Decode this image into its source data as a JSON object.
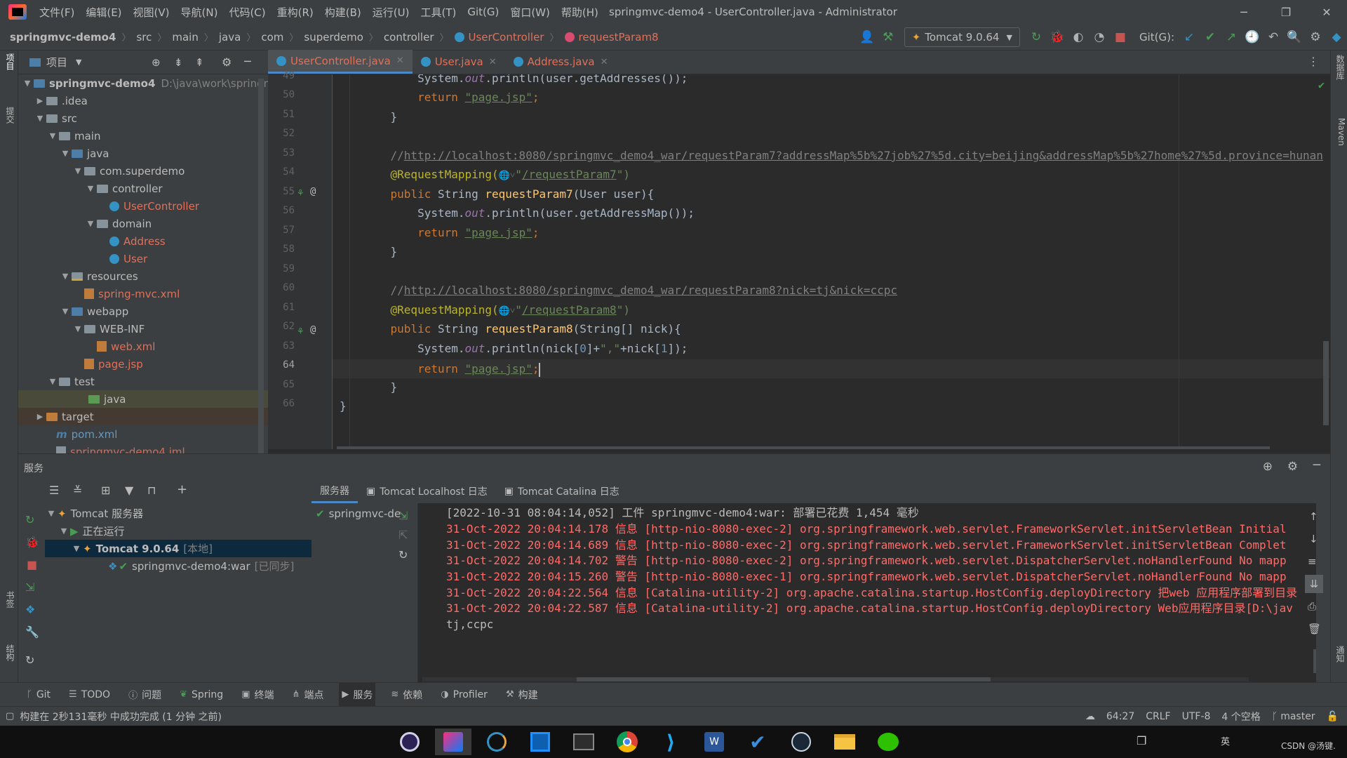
{
  "window": {
    "title": "springmvc-demo4 - UserController.java - Administrator",
    "menu": [
      "文件(F)",
      "编辑(E)",
      "视图(V)",
      "导航(N)",
      "代码(C)",
      "重构(R)",
      "构建(B)",
      "运行(U)",
      "工具(T)",
      "Git(G)",
      "窗口(W)",
      "帮助(H)"
    ],
    "minimize": "─",
    "restore": "❐",
    "close": "✕"
  },
  "navbar": {
    "breadcrumbs": [
      "springmvc-demo4",
      "src",
      "main",
      "java",
      "com",
      "superdemo",
      "controller",
      "UserController",
      "requestParam8"
    ],
    "run_config": "Tomcat 9.0.64",
    "git_label": "Git(G):"
  },
  "left_strip": {
    "project_tab": "项目",
    "commit_tab": "提交",
    "bookmarks_tab": "书签",
    "structure_tab": "结构"
  },
  "right_strip": {
    "database_tab": "数据库",
    "maven_tab": "Maven",
    "notifications_tab": "通知"
  },
  "project": {
    "header": "项目",
    "root_name": "springmvc-demo4",
    "root_path": "D:\\java\\work\\springm",
    "items": [
      ".idea",
      "src",
      "main",
      "java",
      "com.superdemo",
      "controller",
      "UserController",
      "domain",
      "Address",
      "User",
      "resources",
      "spring-mvc.xml",
      "webapp",
      "WEB-INF",
      "web.xml",
      "page.jsp",
      "test",
      "java",
      "target",
      "pom.xml",
      "springmvc-demo4.iml"
    ]
  },
  "editor": {
    "tabs": [
      "UserController.java",
      "User.java",
      "Address.java"
    ],
    "line_numbers": [
      "49",
      "50",
      "51",
      "52",
      "53",
      "54",
      "55",
      "56",
      "57",
      "58",
      "59",
      "60",
      "61",
      "62",
      "63",
      "64",
      "65",
      "66"
    ],
    "current_line": "64",
    "code": {
      "l49a": "        System.",
      "l49b": "out",
      "l49c": ".println(user.getAddresses());",
      "l50kw": "        return ",
      "l50s": "\"page.jsp\"",
      "semi": ";",
      "l51": "    }",
      "l53a": "    //",
      "l53url": "http://localhost:8080/springmvc_demo4_war/requestParam7?addressMap%5b%27job%27%5d.city=beijing&addressMap%5b%27home%27%5d.province=hunan",
      "l54ann": "    @RequestMapping(",
      "l54q": "\"",
      "l54url": "/requestParam7",
      "l54end": "\")",
      "l55kw": "    public ",
      "l55type": "String ",
      "l55fn": "requestParam7",
      "l55rest": "(User user){",
      "l56c": ".println(user.getAddressMap());",
      "l58": "    }",
      "l60url": "http://localhost:8080/springmvc_demo4_war/requestParam8?nick=tj&nick=ccpc",
      "l61url": "/requestParam8",
      "l62fn": "requestParam8",
      "l62rest": "(String[] nick){",
      "l63c": ".println(nick[",
      "l63n0": "0",
      "l63m": "]+",
      "l63s": "\",\"",
      "l63m2": "+nick[",
      "l63n1": "1",
      "l63e": "]);",
      "l65": "    }",
      "l66": "}"
    }
  },
  "services": {
    "title": "服务",
    "tree": {
      "tomcat_server": "Tomcat 服务器",
      "running": "正在运行",
      "tomcat_name": "Tomcat 9.0.64",
      "tomcat_tag": "[本地]",
      "artifact": "springmvc-demo4:war",
      "artifact_tag": "[已同步]"
    },
    "sub_tabs": [
      "服务器",
      "Tomcat Localhost 日志",
      "Tomcat Catalina 日志"
    ],
    "deploy_item": "springmvc-de",
    "log_lines": [
      "[2022-10-31 08:04:14,052] 工件 springmvc-demo4:war: 部署已花费 1,454 毫秒",
      "31-Oct-2022 20:04:14.178 信息 [http-nio-8080-exec-2] org.springframework.web.servlet.FrameworkServlet.initServletBean Initial",
      "31-Oct-2022 20:04:14.689 信息 [http-nio-8080-exec-2] org.springframework.web.servlet.FrameworkServlet.initServletBean Complet",
      "31-Oct-2022 20:04:14.702 警告 [http-nio-8080-exec-2] org.springframework.web.servlet.DispatcherServlet.noHandlerFound No mapp",
      "31-Oct-2022 20:04:15.260 警告 [http-nio-8080-exec-1] org.springframework.web.servlet.DispatcherServlet.noHandlerFound No mapp",
      "31-Oct-2022 20:04:22.564 信息 [Catalina-utility-2] org.apache.catalina.startup.HostConfig.deployDirectory 把web 应用程序部署到目录",
      "31-Oct-2022 20:04:22.587 信息 [Catalina-utility-2] org.apache.catalina.startup.HostConfig.deployDirectory Web应用程序目录[D:\\jav",
      "tj,ccpc"
    ]
  },
  "bottom_tools": [
    "Git",
    "TODO",
    "问题",
    "Spring",
    "终端",
    "端点",
    "服务",
    "依赖",
    "Profiler",
    "构建"
  ],
  "status": {
    "message": "构建在 2秒131毫秒 中成功完成 (1 分钟 之前)",
    "position": "64:27",
    "line_sep": "CRLF",
    "encoding": "UTF-8",
    "indent": "4 个空格",
    "branch": "master"
  },
  "taskbar": {
    "ime": "英",
    "watermark": "CSDN @汤键."
  }
}
